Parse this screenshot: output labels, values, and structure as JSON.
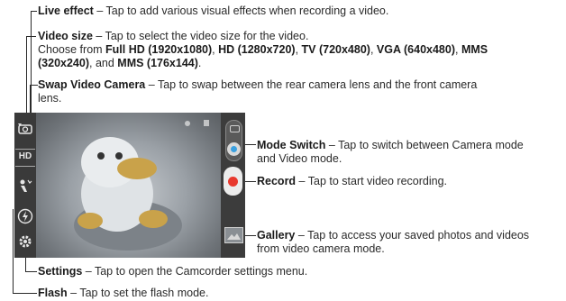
{
  "annotations": {
    "live_effect": {
      "title": "Live effect",
      "desc": " – Tap to add various visual effects when recording a video."
    },
    "video_size": {
      "title": "Video size",
      "desc": " – Tap to select the video size for the video.",
      "line2_prefix": "Choose from ",
      "opt1": "Full HD (1920x1080)",
      "sep1": ", ",
      "opt2": "HD (1280x720)",
      "sep2": ", ",
      "opt3": "TV (720x480)",
      "sep3": ", ",
      "opt4": "VGA (640x480)",
      "sep4": ", ",
      "opt5": "MMS",
      "opt5b": "(320x240)",
      "sep5": ", and ",
      "opt6": "MMS (176x144)",
      "end": "."
    },
    "swap_camera": {
      "title": "Swap Video Camera",
      "desc": " – Tap to swap between the rear camera lens and the front camera",
      "desc2": "lens."
    },
    "mode_switch": {
      "title": "Mode Switch",
      "desc": " – Tap to switch between Camera mode",
      "desc2": "and Video mode."
    },
    "record": {
      "title": "Record",
      "desc": " – Tap to start video recording."
    },
    "gallery": {
      "title": "Gallery",
      "desc": " – Tap to access your saved photos and videos",
      "desc2": "from video camera mode."
    },
    "settings": {
      "title": "Settings",
      "desc": " – Tap to open the Camcorder settings menu."
    },
    "flash": {
      "title": "Flash",
      "desc": " – Tap to set the flash mode."
    }
  },
  "screen_icons": {
    "hd_label": "HD",
    "swap": "swap-camera-icon",
    "effect": "live-effect-icon",
    "flash": "flash-icon",
    "settings": "settings-gear-icon"
  },
  "colors": {
    "record": "#e8392e",
    "mode_switch": "#3aa0e0"
  }
}
